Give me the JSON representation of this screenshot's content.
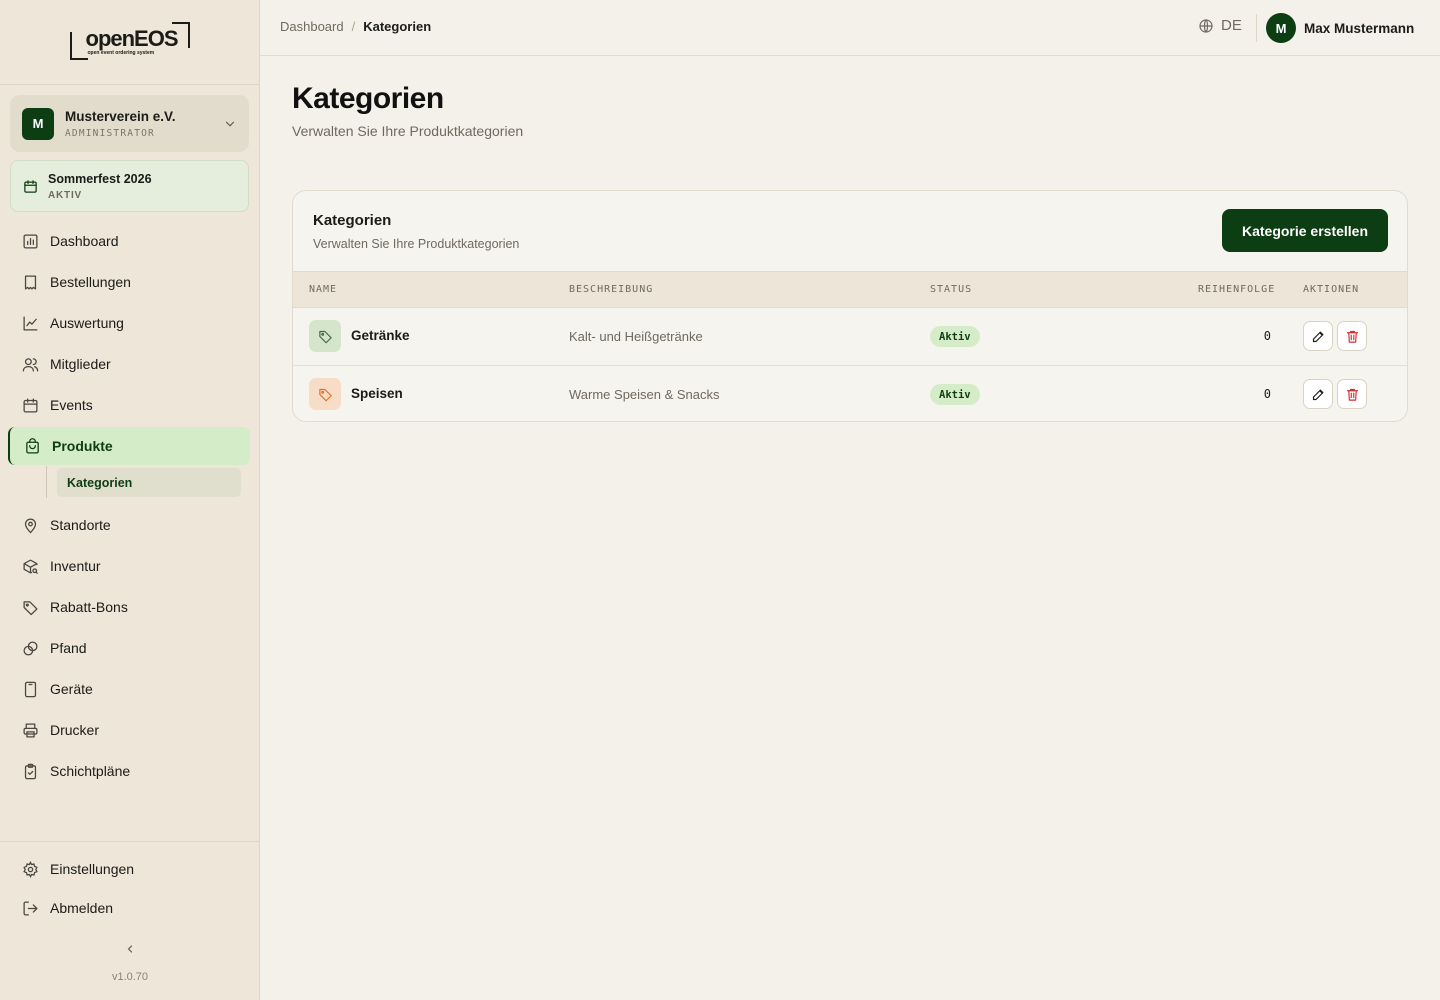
{
  "logo": {
    "word": "openEOS",
    "tagline": "open event ordering system"
  },
  "org": {
    "initial": "M",
    "name": "Musterverein e.V.",
    "role": "ADMINISTRATOR"
  },
  "event": {
    "name": "Sommerfest 2026",
    "status": "AKTIV"
  },
  "nav": {
    "dashboard": "Dashboard",
    "bestellungen": "Bestellungen",
    "auswertung": "Auswertung",
    "mitglieder": "Mitglieder",
    "events": "Events",
    "produkte": "Produkte",
    "kategorien": "Kategorien",
    "standorte": "Standorte",
    "inventur": "Inventur",
    "rabatt": "Rabatt-Bons",
    "pfand": "Pfand",
    "geraete": "Geräte",
    "drucker": "Drucker",
    "schichtplaene": "Schichtpläne",
    "einstellungen": "Einstellungen",
    "abmelden": "Abmelden"
  },
  "version": "v1.0.70",
  "breadcrumb": {
    "root": "Dashboard",
    "sep": "/",
    "current": "Kategorien"
  },
  "lang": "DE",
  "user": {
    "initial": "M",
    "name": "Max Mustermann"
  },
  "page": {
    "title": "Kategorien",
    "subtitle": "Verwalten Sie Ihre Produktkategorien"
  },
  "card": {
    "title": "Kategorien",
    "subtitle": "Verwalten Sie Ihre Produktkategorien",
    "create_label": "Kategorie erstellen"
  },
  "table": {
    "headers": {
      "name": "NAME",
      "beschreibung": "BESCHREIBUNG",
      "status": "STATUS",
      "reihenfolge": "REIHENFOLGE",
      "aktionen": "AKTIONEN"
    },
    "rows": [
      {
        "name": "Getränke",
        "description": "Kalt- und Heißgetränke",
        "status": "Aktiv",
        "order": "0",
        "icon": "tag-icon",
        "icon_color": "#3d6b3f",
        "icon_bg": "#d4e5cc"
      },
      {
        "name": "Speisen",
        "description": "Warme Speisen & Snacks",
        "status": "Aktiv",
        "order": "0",
        "icon": "tag-icon",
        "icon_color": "#e0702a",
        "icon_bg": "#f7dcc6"
      }
    ]
  },
  "colors": {
    "accent": "#0d3d12",
    "active_bg": "#d5ecc8",
    "danger": "#d32f2f"
  }
}
